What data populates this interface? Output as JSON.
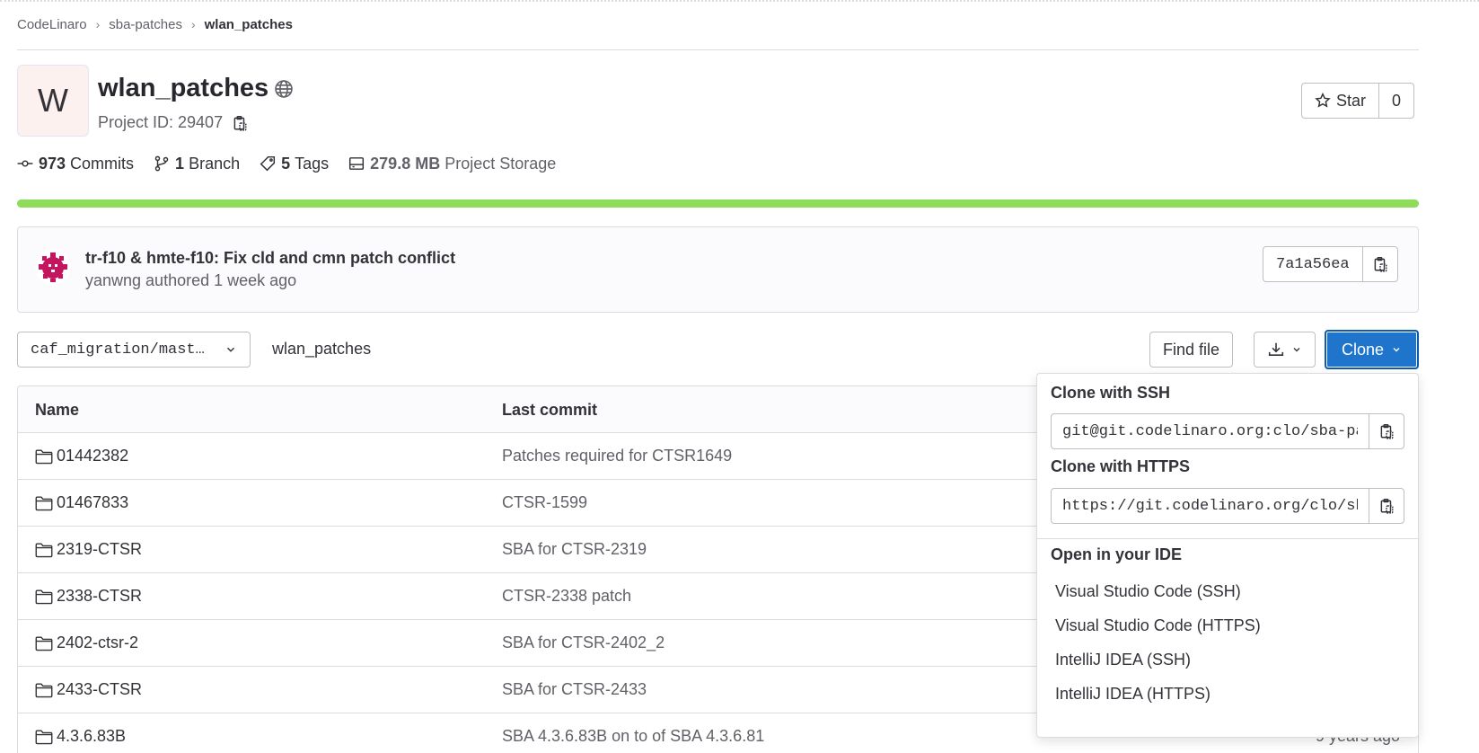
{
  "breadcrumb": [
    "CodeLinaro",
    "sba-patches",
    "wlan_patches"
  ],
  "project": {
    "avatar_letter": "W",
    "title": "wlan_patches",
    "project_id_label": "Project ID: 29407",
    "star_label": "Star",
    "star_count": "0"
  },
  "stats": {
    "commits_count": "973",
    "commits_label": "Commits",
    "branch_count": "1",
    "branch_label": "Branch",
    "tags_count": "5",
    "tags_label": "Tags",
    "storage_size": "279.8 MB",
    "storage_label": "Project Storage"
  },
  "storage_bar_fraction": 1.0,
  "last_commit": {
    "title": "tr-f10 & hmte-f10: Fix cld and cmn patch conflict",
    "meta": "yanwng authored 1 week ago",
    "sha": "7a1a56ea"
  },
  "toolbar": {
    "branch": "caf_migration/mast…",
    "path": "wlan_patches",
    "find_file": "Find file",
    "clone": "Clone"
  },
  "table": {
    "headers": [
      "Name",
      "Last commit"
    ],
    "rows": [
      {
        "name": "01442382",
        "msg": "Patches required for CTSR1649",
        "time": ""
      },
      {
        "name": "01467833",
        "msg": "CTSR-1599",
        "time": ""
      },
      {
        "name": "2319-CTSR",
        "msg": "SBA for CTSR-2319",
        "time": ""
      },
      {
        "name": "2338-CTSR",
        "msg": "CTSR-2338 patch",
        "time": ""
      },
      {
        "name": "2402-ctsr-2",
        "msg": "SBA for CTSR-2402_2",
        "time": ""
      },
      {
        "name": "2433-CTSR",
        "msg": "SBA for CTSR-2433",
        "time": ""
      },
      {
        "name": "4.3.6.83B",
        "msg": "SBA 4.3.6.83B on to of SBA 4.3.6.81",
        "time": "9 years ago"
      }
    ]
  },
  "clone_dropdown": {
    "ssh_heading": "Clone with SSH",
    "ssh_url": "git@git.codelinaro.org:clo/sba-patches/wlan_patches.git",
    "https_heading": "Clone with HTTPS",
    "https_url": "https://git.codelinaro.org/clo/sba-patches/wlan_patches.git",
    "ide_heading": "Open in your IDE",
    "ide_items": [
      "Visual Studio Code (SSH)",
      "Visual Studio Code (HTTPS)",
      "IntelliJ IDEA (SSH)",
      "IntelliJ IDEA (HTTPS)"
    ]
  },
  "colors": {
    "primary": "#1f75cb",
    "storage_bar": "#8fdc5a",
    "avatar_bg": "#fcf1ef"
  }
}
